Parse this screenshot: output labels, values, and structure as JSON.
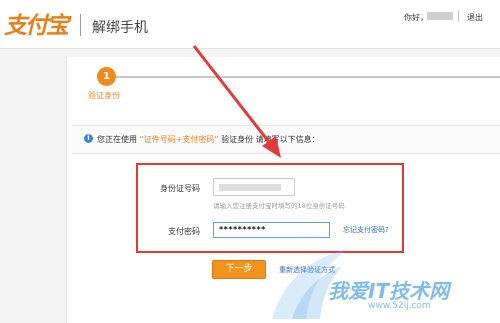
{
  "header": {
    "logo_text": "支付宝",
    "page_title": "解绑手机",
    "greeting": "你好，",
    "logout": "退出"
  },
  "steps": {
    "current_number": "1",
    "current_label": "验证身份"
  },
  "notice": {
    "icon_glyph": "i",
    "prefix": "您正在使用",
    "method": "“证件号码+支付密码”",
    "middle": "验证身份",
    "suffix": "请填写以下信息："
  },
  "form": {
    "id_label": "身份证号码",
    "id_hint": "请输入您注册支付宝时填写的18位身份证号码",
    "password_label": "支付密码",
    "password_value": "**********",
    "forgot_link": "忘记支付密码?",
    "next_button": "下一步",
    "reselect_link": "重新选择验证方式"
  },
  "watermark": {
    "text": "我爱IT技术网",
    "url": "www.52ij.com"
  },
  "colors": {
    "accent_orange": "#f08a1c",
    "annotation_red": "#e23a3a",
    "link_blue": "#2a6bc6"
  }
}
